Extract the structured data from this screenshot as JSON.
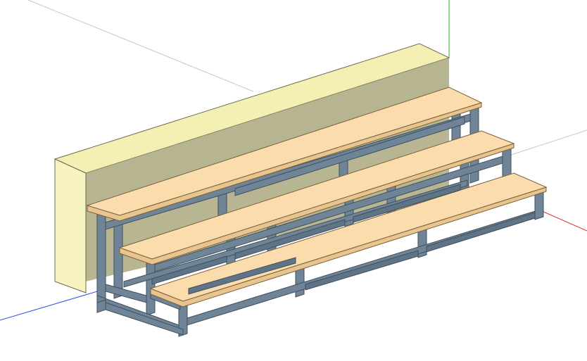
{
  "viewport": {
    "background": "#ffffff",
    "axes": {
      "x_color": "#e03030",
      "y_color": "#22b022",
      "z_color": "#3050e0",
      "grid_color": "#c8c8c8"
    }
  },
  "model": {
    "wall": {
      "front_color": "#f7f4c2",
      "top_color": "#f4f0b4",
      "side_color": "#c3c09c",
      "back_color": "#b8b692"
    },
    "tiers": {
      "count": 3,
      "board_top_color": "#fbdcac",
      "board_edge_color": "#e8c48e",
      "frame_color": "#6f8497",
      "frame_shadow_color": "#4c5e6f",
      "frame_highlight_color": "#98a9b8"
    }
  }
}
